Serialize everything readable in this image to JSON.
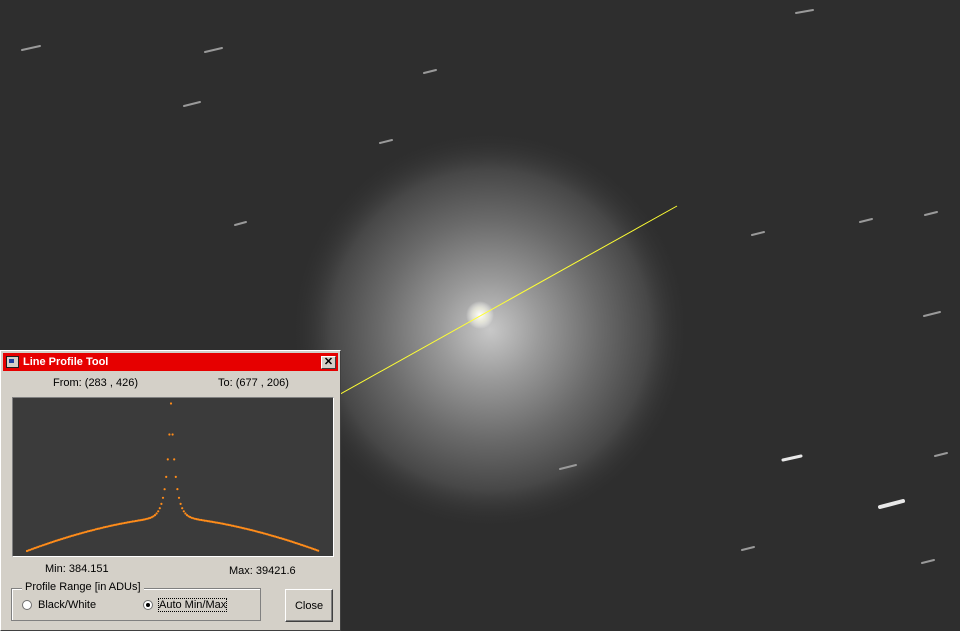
{
  "window": {
    "title": "Line Profile Tool",
    "close_glyph": "✕",
    "from_label": "From: (283 , 426)",
    "to_label": "To: (677 , 206)",
    "min_label": "Min: 384.151",
    "max_label": "Max: 39421.6",
    "profile_range_label": "Profile Range [in ADUs]",
    "radio_black_white": "Black/White",
    "radio_auto_minmax": "Auto Min/Max",
    "selected_range": "Auto Min/Max",
    "close_button": "Close"
  },
  "profile_line": {
    "from": [
      283,
      426
    ],
    "to": [
      677,
      206
    ],
    "color": "#ffff33"
  },
  "chart_data": {
    "type": "line",
    "title": "",
    "xlabel": "",
    "ylabel": "",
    "ylim": [
      384.151,
      39421.6
    ],
    "series_color": "#ff8c1a",
    "min": 384.151,
    "max": 39421.6
  },
  "colors": {
    "title_bar": "#e60000",
    "window_bg": "#d4d0c8",
    "plot_bg": "#3b3b3b",
    "sky_bg": "#2e2e2e"
  }
}
